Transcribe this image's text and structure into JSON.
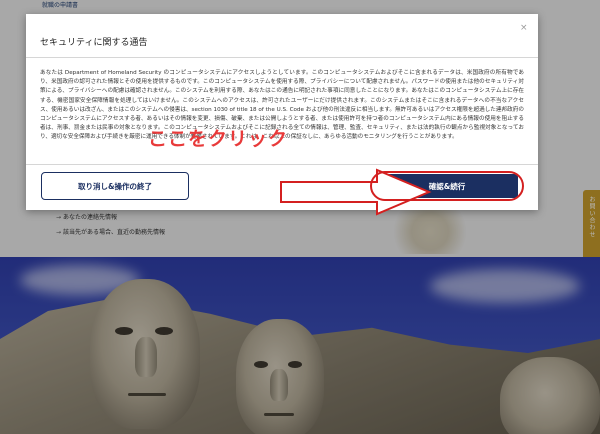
{
  "page": {
    "top_text": "就職の申請書",
    "list_items": [
      "あなたの連絡先情報",
      "該当先がある場合、直近の勤務先情報"
    ],
    "side_tab_label": "お問い合わせ"
  },
  "modal": {
    "title": "セキュリティに関する通告",
    "close_icon": "×",
    "body": "あなたは Department of Homeland Security のコンピュータシステムにアクセスしようとしています。このコンピュータシステムおよびそこに含まれるデータは、米国政府の所有物であり、米国政府の認可された情報とその使用を提供するものです。このコンピュータシステムを使用する際、プライバシーについて配慮されません。パスワードの使用または他のセキュリティ対策による、プライバシーへの配慮は確認されません。このシステムを利用する際、あなたはこの通告に明記された事項に同意したことになります。あなたはこのコンピュータシステム上に存在する、機密国家安全保障情報を処理してはいけません。このシステムへのアクセスは、許可されたユーザーにだけ提供されます。このシステムまたはそこに含まれるデータへの不当なアクセス、使用あるいは改ざん、またはこのシステムへの侵害は、section 1030 of title 18 of the U.S. Code および他の刑法違反に相当します。無許可あるいはアクセス権限を超過した連邦政府のコンピュータシステムにアクセスする者、あるいはその情報を変更、損傷、破棄、または公開しようとする者、または使用許可を持つ者のコンピュータシステム内にある情報の使用を阻止する者は、刑事、罰金または民事の対象となります。このコンピュータシステムおよびそこに記録される全ての情報は、管理、監査、セキュリティ、または法的執行の観点から監視対象となっており、適切な安全保障および手続きを厳密に運用できる体制が整備されています。これは、これ以上の保証なしに、あらゆる活動のモニタリングを行うことがあります。",
    "cancel_button": "取り消し&操作の終了",
    "confirm_button": "確認&続行"
  },
  "annotation": {
    "text": "ここをクリック",
    "color": "#e83a3a"
  },
  "colors": {
    "primary": "#1b2f61",
    "accent_gold": "#c59a2c",
    "sky": "#3a4db5"
  }
}
